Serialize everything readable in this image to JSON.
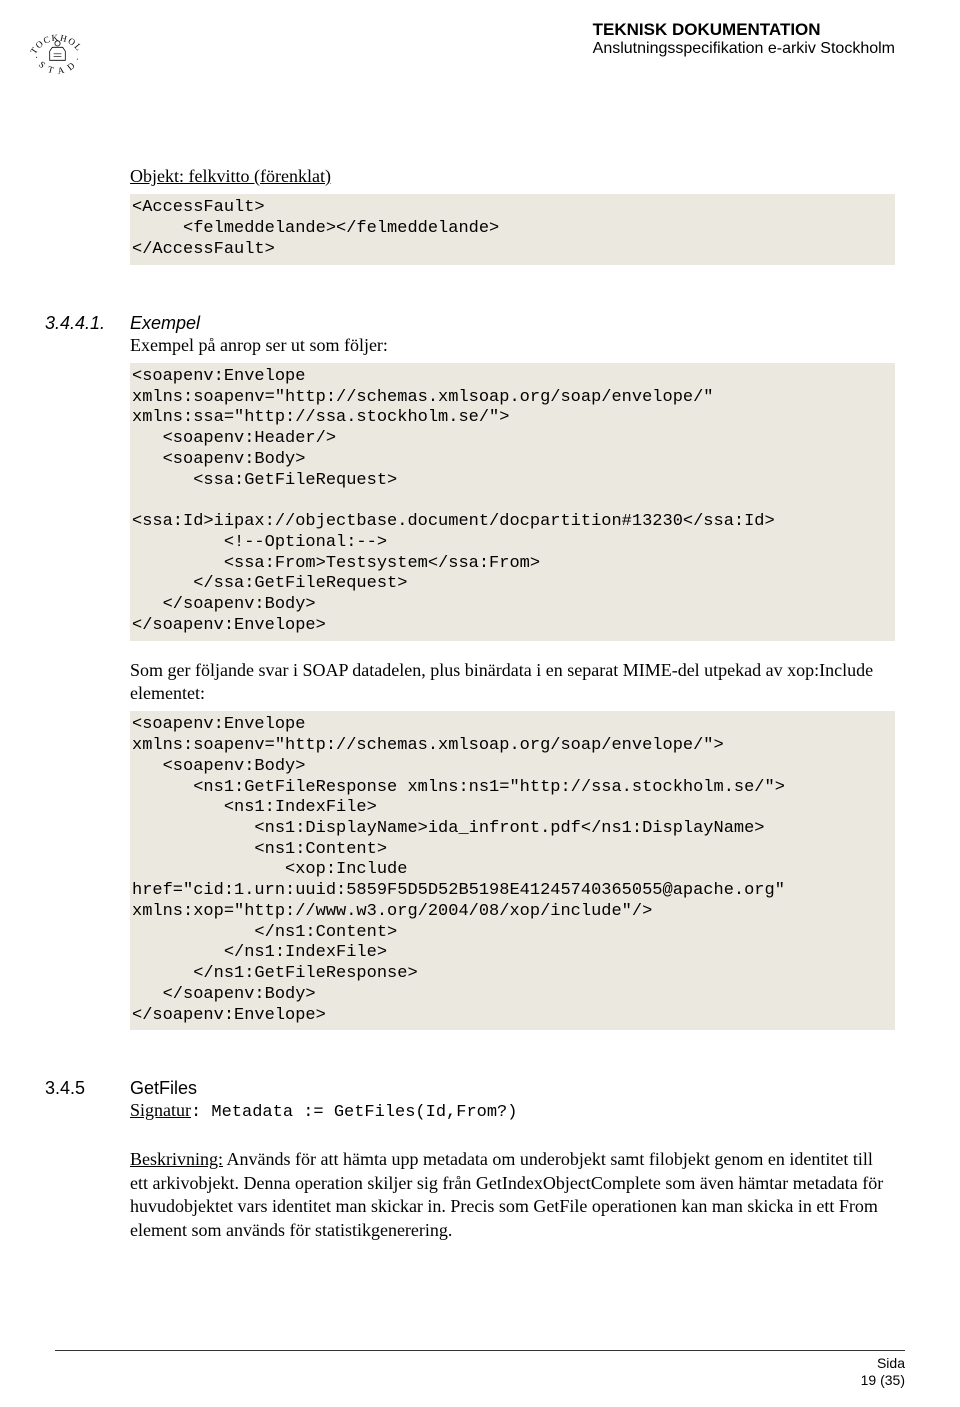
{
  "header": {
    "title": "TEKNISK DOKUMENTATION",
    "subtitle": "Anslutningsspecifikation e-arkiv Stockholm"
  },
  "obj": {
    "heading": "Objekt: felkvitto (förenklat)",
    "code": "<AccessFault>\n     <felmeddelande></felmeddelande>\n</AccessFault>"
  },
  "sec34441": {
    "num": "3.4.4.1.",
    "title": "Exempel",
    "intro": "Exempel på anrop ser ut som följer:",
    "code1": "<soapenv:Envelope\nxmlns:soapenv=\"http://schemas.xmlsoap.org/soap/envelope/\"\nxmlns:ssa=\"http://ssa.stockholm.se/\">\n   <soapenv:Header/>\n   <soapenv:Body>\n      <ssa:GetFileRequest>\n\n<ssa:Id>iipax://objectbase.document/docpartition#13230</ssa:Id>\n         <!--Optional:-->\n         <ssa:From>Testsystem</ssa:From>\n      </ssa:GetFileRequest>\n   </soapenv:Body>\n</soapenv:Envelope>",
    "between": "Som ger följande svar i SOAP datadelen, plus binärdata i en separat MIME-del utpekad av xop:Include elementet:",
    "code2": "<soapenv:Envelope\nxmlns:soapenv=\"http://schemas.xmlsoap.org/soap/envelope/\">\n   <soapenv:Body>\n      <ns1:GetFileResponse xmlns:ns1=\"http://ssa.stockholm.se/\">\n         <ns1:IndexFile>\n            <ns1:DisplayName>ida_infront.pdf</ns1:DisplayName>\n            <ns1:Content>\n               <xop:Include\nhref=\"cid:1.urn:uuid:5859F5D5D52B5198E41245740365055@apache.org\"\nxmlns:xop=\"http://www.w3.org/2004/08/xop/include\"/>\n            </ns1:Content>\n         </ns1:IndexFile>\n      </ns1:GetFileResponse>\n   </soapenv:Body>\n</soapenv:Envelope>\n"
  },
  "sec345": {
    "num": "3.4.5",
    "title": "GetFiles",
    "sig_label": "Signatur",
    "sig_code": ": Metadata := GetFiles(Id,From?)",
    "desc_label": "Beskrivning:",
    "desc_text": " Används för att hämta upp metadata om underobjekt samt filobjekt genom en identitet till ett arkivobjekt. Denna operation skiljer sig från GetIndexObjectComplete som även hämtar metadata för huvudobjektet vars identitet man skickar in. Precis som GetFile operationen kan man skicka in ett From element som används för statistikgenerering."
  },
  "footer": {
    "label": "Sida",
    "value": "19 (35)"
  }
}
